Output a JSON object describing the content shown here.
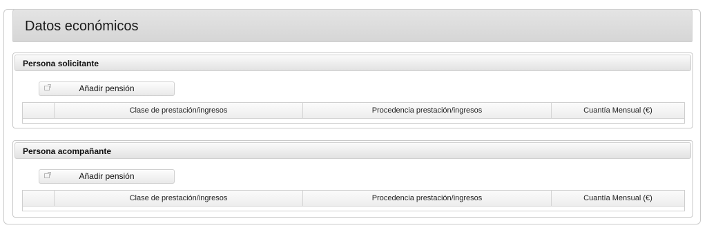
{
  "section_title": "Datos económicos",
  "panels": [
    {
      "title": "Persona solicitante",
      "add_label": "Añadir pensión",
      "columns": [
        "",
        "Clase de prestación/ingresos",
        "Procedencia prestación/ingresos",
        "Cuantía Mensual (€)"
      ]
    },
    {
      "title": "Persona acompañante",
      "add_label": "Añadir pensión",
      "columns": [
        "",
        "Clase de prestación/ingresos",
        "Procedencia prestación/ingresos",
        "Cuantía Mensual (€)"
      ]
    }
  ]
}
